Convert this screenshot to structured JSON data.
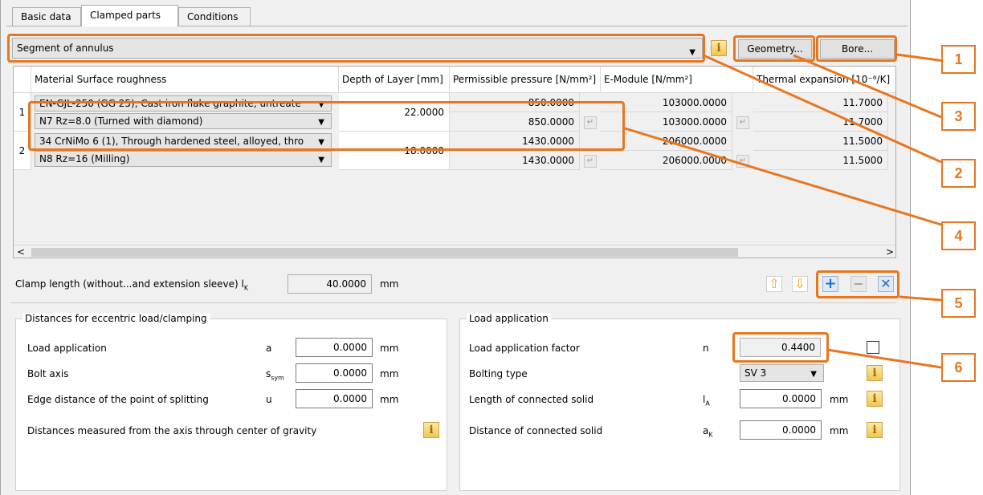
{
  "tabs": [
    "Basic data",
    "Clamped parts",
    "Conditions"
  ],
  "shape": {
    "value": "Segment of annulus",
    "geometry_btn": "Geometry...",
    "bore_btn": "Bore..."
  },
  "table": {
    "headers": [
      "Material Surface roughness",
      "Depth of Layer [mm]",
      "Permissible pressure [N/mm²]",
      "E-Module [N/mm²]",
      "Thermal expansion [10⁻⁶/K]"
    ],
    "rows": [
      {
        "index": "1",
        "material": "EN-GJL-250 (GG 25), Cast iron flake graphite, untreate",
        "roughness": "N7  Rz=8.0 (Turned with diamond)",
        "depth": "22.0000",
        "pressure_a": "850.0000",
        "pressure_b": "850.0000",
        "emod_a": "103000.0000",
        "emod_b": "103000.0000",
        "therm_a": "11.7000",
        "therm_b": "11.7000"
      },
      {
        "index": "2",
        "material": "34 CrNiMo 6 (1), Through hardened steel, alloyed, thro",
        "roughness": "N8  Rz=16  (Milling)",
        "depth": "18.0000",
        "pressure_a": "1430.0000",
        "pressure_b": "1430.0000",
        "emod_a": "206000.0000",
        "emod_b": "206000.0000",
        "therm_a": "11.5000",
        "therm_b": "11.5000"
      }
    ]
  },
  "clamp": {
    "label": "Clamp length (without...and extension sleeve)  l",
    "sub": "K",
    "value": "40.0000",
    "unit": "mm"
  },
  "distances": {
    "title": "Distances for eccentric load/clamping",
    "rows": [
      {
        "label": "Load application",
        "sym": "a",
        "sub": "",
        "value": "0.0000",
        "unit": "mm"
      },
      {
        "label": "Bolt axis",
        "sym": "s",
        "sub": "sym",
        "value": "0.0000",
        "unit": "mm"
      },
      {
        "label": "Edge distance of the point of splitting",
        "sym": "u",
        "sub": "",
        "value": "0.0000",
        "unit": "mm"
      }
    ],
    "note": "Distances measured from the axis through center of gravity"
  },
  "load": {
    "title": "Load application",
    "factor_label": "Load application factor",
    "factor_sym": "n",
    "factor_value": "0.4400",
    "bolting_label": "Bolting type",
    "bolting_value": "SV 3",
    "length_label": "Length of connected solid",
    "length_sym": "l",
    "length_sub": "A",
    "length_value": "0.0000",
    "length_unit": "mm",
    "dist_label": "Distance of connected solid",
    "dist_sym": "a",
    "dist_sub": "K",
    "dist_value": "0.0000",
    "dist_unit": "mm"
  },
  "callouts": [
    "1",
    "2",
    "3",
    "4",
    "5",
    "6"
  ],
  "info_glyph": "i",
  "colors": {
    "callout": "#e8761f",
    "accent": "#1e6fc7"
  }
}
